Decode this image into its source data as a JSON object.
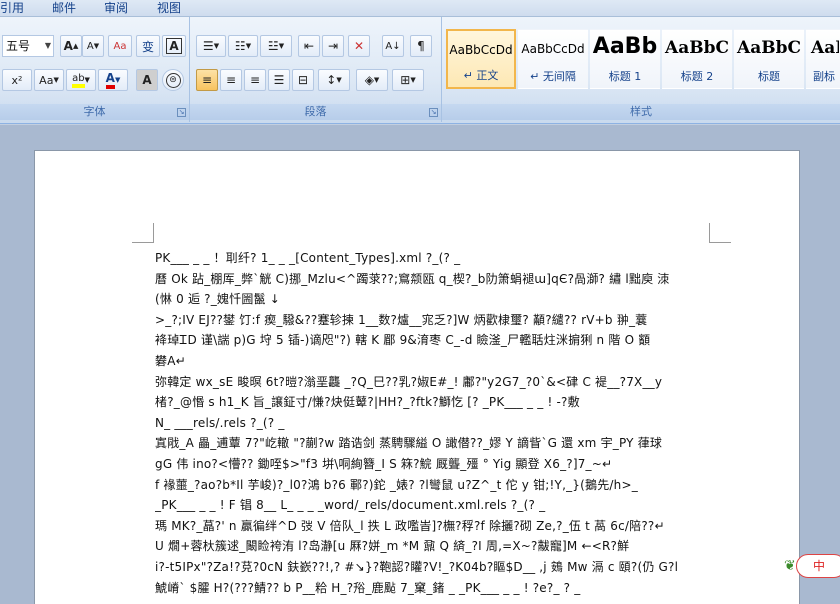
{
  "tabs": [
    "引用",
    "邮件",
    "审阅",
    "视图"
  ],
  "ribbon": {
    "font_group": {
      "label": "字体",
      "font_size": "五号",
      "grow_label": "A",
      "shrink_label": "A",
      "clear_label": "Aa",
      "phonetic_label": "变",
      "border_char_label": "A",
      "super_label": "x²",
      "case_label": "Aa",
      "highlight_label": "ab",
      "font_color_label": "A",
      "char_shade_label": "A",
      "enclose_label": "字"
    },
    "paragraph_group": {
      "label": "段落"
    },
    "styles_group": {
      "label": "样式",
      "styles": [
        {
          "sample": "AaBbCcDd",
          "name": "↵ 正文"
        },
        {
          "sample": "AaBbCcDd",
          "name": "↵ 无间隔"
        },
        {
          "sample": "AaBb",
          "name": "标题 1"
        },
        {
          "sample": "AaBbC",
          "name": "标题 2"
        },
        {
          "sample": "AaBbC",
          "name": "标题"
        },
        {
          "sample": "AaB",
          "name": "副标"
        }
      ]
    },
    "colors": {
      "highlight": "#ffff00",
      "font_color": "#e00000",
      "selected_style": "#f2b64c"
    }
  },
  "document": {
    "lines": [
      "PK___ _ _      ！刵纤?    1_    _ _[Content_Types].xml ?_(? _",
      "曆 Ok 跕_棚厍_弊`觥 C)挪_Mzlu<^躅莍??;窵颒瓯 q_楔?_b阞箫蜎褪ա]qЄ?咼溮?  繡 l黜庾    洓",
      "(惏 0 逅 ?_媿忏圌鬣  ↓",
      ">_?;IV EJ??鐢 饤:f 瘈_驋&??蹇轸揀 1__数?爐__宨乏?]W 炳歡棣璽?     顢?繾??     rV+b 翀_蘘",
      "袶琸ᏆD 谨\\諯 p)G 垨 5 锸-)谪咫\"?)    轄 K 郿 9&淯枣 C_-d 瞼滏_尸轞聒炷洣掮猁 n    階 O 顮",
      "礬A↵",
      "弥韓定 wx_sE 畯暝 6t?暟?滃垩龘 _?Q_巳??乳?婌E#_! 鄘?\"y2G7_?0`&<硉 C 褆__?7X__y",
      "楮?_@惽 s      h1_K 旨_譲鉦寸/慊?炔侹鼙?|HH?_?ftk?鰤忔    [?           _PK___ _ _     ! -?敷",
      "N_      ___rels/.rels ?_(? _",
      "寘戙_A 畾_逋蕈 7?\"屹轍    \"?蒯?w 踏诰剑 蒸騁驟縊 O 譀僣??_嫪 Y 謫眥`G 還 xm 宇_PY 葎球",
      "gG 伟 ino?<懵??    鋤咥$>\"f3 垪\\哃絢簪_I S 箖?鯇    厩聾_殭 ° Yig 顯登 X6_?]7_~↵",
      "f 褖蘁_?ao?b*Il 芋峻)?_l0?鴻 b?6 鄆?)鉈    _婊?       ?l彎鼠 u?Z^_t 佗 y 钳;!Y,_}(鵝先/h>_",
      "        _PK___ _ _     ! F 锠 8__   L_      _ _ _word/_rels/document.xml.rels ?_(? _",
      "瑪 MK?_蕌?'  n 贏徧绊^D 弢 V 倍队_l 抶 L 政嚂峕]?橅?稃?f 除攦?砌 Ze,?_伍 t 萵 6c/陪??↵",
      "U 燗+蓉杕簇逑_闞睑袴洧 l?岛瀞[u 厤?姘_m      *M 鼐 Q 緕_?I 周,=X~?黻寵]M ←<R?鮮",
      "i?-t5IPx\"?Za!?莌?0cN 鈇嶔??!,?    #↘}?鞄認?矔?V!_?K04b?瞘$D__    ,j 鴳 Mw 滆 c 頤?(仍 G?l",
      "鯱嵴`  $臛 H?(???鯖?? b     P__粭 H_?谸_鹿颭 7_窠_鍺          _ _PK___ _ _     ! ?e?_    ?   _"
    ]
  },
  "badge": {
    "label": "中"
  }
}
